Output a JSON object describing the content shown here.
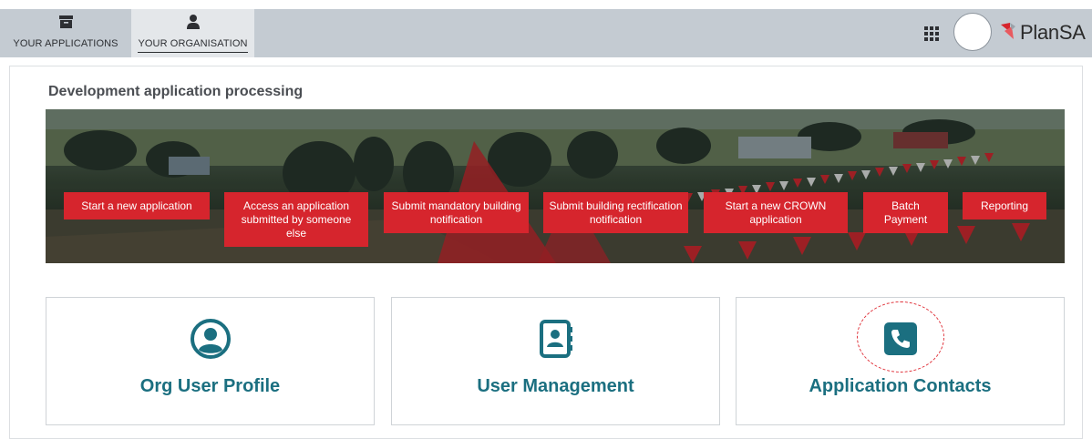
{
  "nav": {
    "tabs": [
      {
        "label": "YOUR APPLICATIONS",
        "icon": "archive-box-icon"
      },
      {
        "label": "YOUR ORGANISATION",
        "icon": "person-icon",
        "active": true
      }
    ],
    "logo_text": "PlanSA"
  },
  "section": {
    "title": "Development application processing"
  },
  "actions": [
    {
      "label": "Start a new application"
    },
    {
      "label": "Access an application submitted by someone else"
    },
    {
      "label": "Submit mandatory building notification"
    },
    {
      "label": "Submit building rectification notification"
    },
    {
      "label": "Start a new CROWN application"
    },
    {
      "label": "Batch Payment"
    },
    {
      "label": "Reporting"
    }
  ],
  "cards": [
    {
      "title": "Org User Profile",
      "icon": "user-circle-icon"
    },
    {
      "title": "User Management",
      "icon": "address-book-icon"
    },
    {
      "title": "Application Contacts",
      "icon": "phone-square-icon"
    }
  ],
  "colors": {
    "accent_red": "#d6252d",
    "card_teal": "#1b6f80",
    "topbar": "#c4cbd2"
  }
}
